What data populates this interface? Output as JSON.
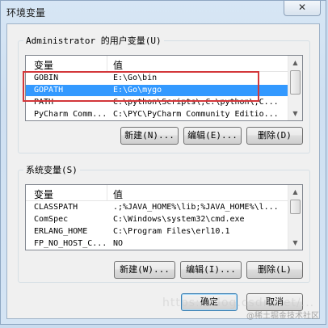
{
  "window": {
    "title": "环境变量",
    "close_glyph": "✕"
  },
  "user_vars": {
    "label": "Administrator 的用户变量(U)",
    "columns": [
      "变量",
      "值"
    ],
    "rows": [
      {
        "name": "GOBIN",
        "value": "E:\\Go\\bin",
        "selected": false
      },
      {
        "name": "GOPATH",
        "value": "E:\\Go\\mygo",
        "selected": true
      },
      {
        "name": "PATH",
        "value": "C:\\python\\Scripts\\;C:\\python\\;C...",
        "selected": false
      },
      {
        "name": "PyCharm Comm...",
        "value": "C:\\PYC\\PyCharm Community Editio...",
        "selected": false
      }
    ],
    "buttons": {
      "new": "新建(N)...",
      "edit": "编辑(E)...",
      "delete": "删除(D)"
    }
  },
  "system_vars": {
    "label": "系统变量(S)",
    "columns": [
      "变量",
      "值"
    ],
    "rows": [
      {
        "name": "CLASSPATH",
        "value": ".;%JAVA_HOME%\\lib;%JAVA_HOME%\\l...",
        "selected": false
      },
      {
        "name": "ComSpec",
        "value": "C:\\Windows\\system32\\cmd.exe",
        "selected": false
      },
      {
        "name": "ERLANG_HOME",
        "value": "C:\\Program Files\\erl10.1",
        "selected": false
      },
      {
        "name": "FP_NO_HOST_C...",
        "value": "NO",
        "selected": false
      }
    ],
    "buttons": {
      "new": "新建(W)...",
      "edit": "编辑(I)...",
      "delete": "删除(L)"
    }
  },
  "footer": {
    "ok": "确定",
    "cancel": "取消"
  },
  "watermark": {
    "text": "@稀土掘金技术社区",
    "blog": "https://blog.csdn.net/..."
  },
  "colors": {
    "selection": "#3399ff",
    "annotation_box": "#d3373a"
  }
}
